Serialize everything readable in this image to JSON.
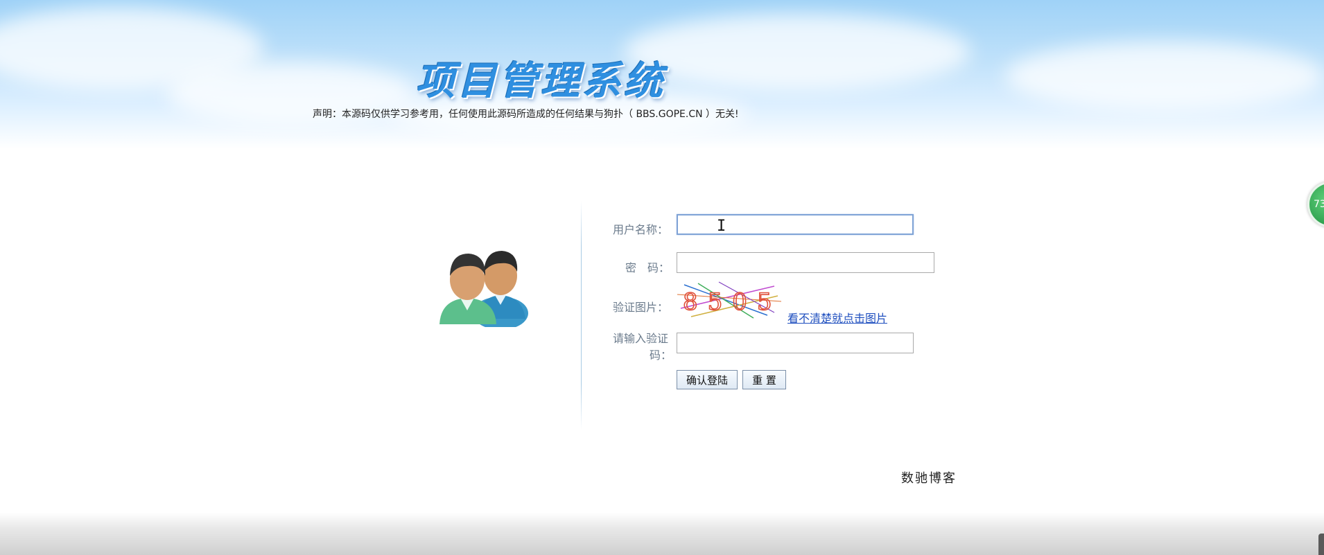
{
  "header": {
    "title": "项目管理系统",
    "notice": "声明：本源码仅供学习参考用，任何使用此源码所造成的任何结果与狗扑（ BBS.GOPE.CN ）无关!"
  },
  "login_form": {
    "username_label": "用户名称：",
    "username_value": "",
    "password_label": "密　码：",
    "password_value": "",
    "captcha_label": "验证图片：",
    "captcha_text": "8505",
    "captcha_refresh_link": "看不清楚就点击图片",
    "captcha_input_label_line1": "请输入验证",
    "captcha_input_label_line2": "码：",
    "captcha_input_value": "",
    "submit_label": "确认登陆",
    "reset_label": "重 置"
  },
  "footer": {
    "text": "数驰博客"
  },
  "float_badge": {
    "text": "73"
  },
  "colors": {
    "sky_top": "#9fd2f7",
    "title_blue": "#2f8fe0",
    "link_blue": "#1f4fbf",
    "label_gray": "#6b7b8c"
  }
}
